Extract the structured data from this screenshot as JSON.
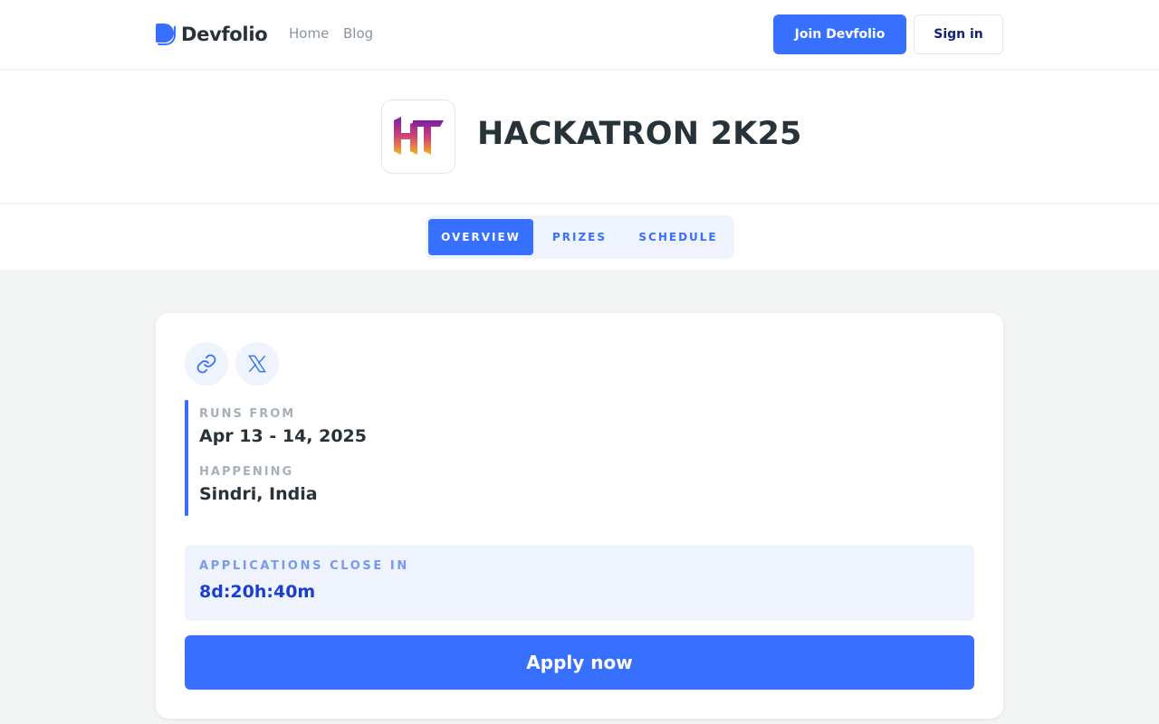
{
  "nav": {
    "logo_text": "Devfolio",
    "links": [
      "Home",
      "Blog"
    ],
    "join_label": "Join Devfolio",
    "signin_label": "Sign in"
  },
  "event": {
    "logo_text": "HT",
    "title": "HACKATRON 2K25"
  },
  "tabs": [
    "OVERVIEW",
    "PRIZES",
    "SCHEDULE"
  ],
  "active_tab": "OVERVIEW",
  "card": {
    "icons": [
      "link-icon",
      "x-twitter-icon"
    ],
    "runs_from_label": "RUNS FROM",
    "runs_from_value": "Apr 13 - 14, 2025",
    "happening_label": "HAPPENING",
    "happening_value": "Sindri, India",
    "deadline_label": "APPLICATIONS CLOSE IN",
    "deadline_value": "8d:20h:40m",
    "apply_label": "Apply now"
  },
  "colors": {
    "accent": "#3770ff",
    "accent_light": "#eef3fd",
    "text_dark": "#273339",
    "text_muted": "#a6b1b6",
    "page_bg": "#f3f5f5"
  }
}
